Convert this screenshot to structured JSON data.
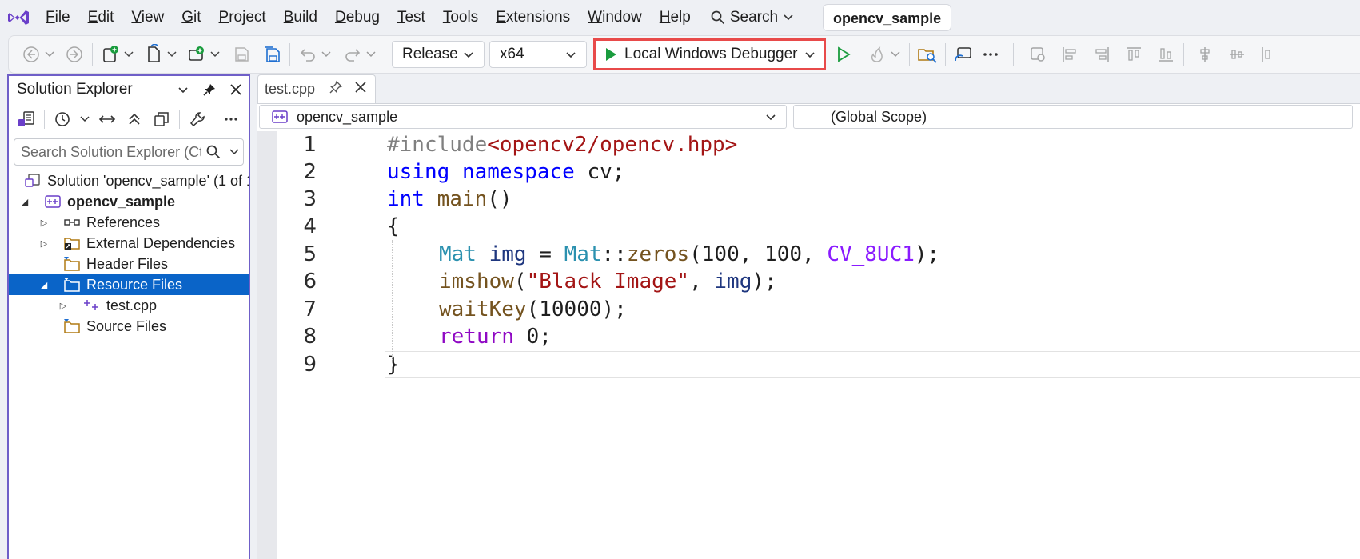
{
  "menubar": {
    "items": [
      "File",
      "Edit",
      "View",
      "Git",
      "Project",
      "Build",
      "Debug",
      "Test",
      "Tools",
      "Extensions",
      "Window",
      "Help"
    ],
    "search_label": "Search",
    "window_title": "opencv_sample"
  },
  "toolbar": {
    "configuration": "Release",
    "platform": "x64",
    "debugger_label": "Local Windows Debugger",
    "accent_color": "#1a9c3e",
    "highlight_color": "#e84a4a"
  },
  "solution_explorer": {
    "title": "Solution Explorer",
    "search_placeholder": "Search Solution Explorer (Ct",
    "tree": {
      "solution": "Solution 'opencv_sample' (1 of 1",
      "project": "opencv_sample",
      "references": "References",
      "external_dependencies": "External Dependencies",
      "header_files": "Header Files",
      "resource_files": "Resource Files",
      "test_cpp": "test.cpp",
      "source_files": "Source Files"
    }
  },
  "editor": {
    "tab_label": "test.cpp",
    "nav_project": "opencv_sample",
    "nav_scope": "(Global Scope)",
    "line_numbers": [
      "1",
      "2",
      "3",
      "4",
      "5",
      "6",
      "7",
      "8",
      "9"
    ],
    "lines": [
      [
        [
          "pp",
          "#include"
        ],
        [
          "str",
          "<opencv2/opencv.hpp>"
        ]
      ],
      [
        [
          "kw",
          "using"
        ],
        [
          "plain",
          " "
        ],
        [
          "kw",
          "namespace"
        ],
        [
          "plain",
          " cv;"
        ]
      ],
      [
        [
          "kw",
          "int"
        ],
        [
          "plain",
          " "
        ],
        [
          "fn",
          "main"
        ],
        [
          "plain",
          "()"
        ]
      ],
      [
        [
          "plain",
          "{"
        ]
      ],
      [
        [
          "type",
          "Mat"
        ],
        [
          "plain",
          " "
        ],
        [
          "var",
          "img"
        ],
        [
          "plain",
          " = "
        ],
        [
          "type",
          "Mat"
        ],
        [
          "plain",
          "::"
        ],
        [
          "fn",
          "zeros"
        ],
        [
          "plain",
          "(100, 100, "
        ],
        [
          "macro",
          "CV_8UC1"
        ],
        [
          "plain",
          ");"
        ]
      ],
      [
        [
          "fn",
          "imshow"
        ],
        [
          "plain",
          "("
        ],
        [
          "str",
          "\"Black Image\""
        ],
        [
          "plain",
          ", "
        ],
        [
          "var",
          "img"
        ],
        [
          "plain",
          ");"
        ]
      ],
      [
        [
          "fn",
          "waitKey"
        ],
        [
          "plain",
          "(10000);"
        ]
      ],
      [
        [
          "kw2",
          "return"
        ],
        [
          "plain",
          " 0;"
        ]
      ],
      [
        [
          "plain",
          "}"
        ]
      ]
    ]
  }
}
